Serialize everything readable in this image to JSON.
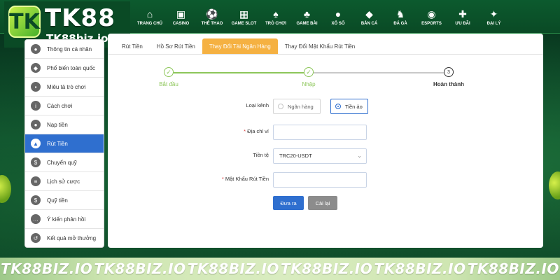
{
  "brand": {
    "logo_letter": "TK",
    "name": "TK88",
    "domain": "TK88biz.io",
    "accent": "#f5b142",
    "primary": "#2f6fcf"
  },
  "nav": [
    {
      "icon": "home-icon",
      "glyph": "⌂",
      "label": "TRANG CHỦ"
    },
    {
      "icon": "casino-icon",
      "glyph": "▣",
      "label": "CASINO"
    },
    {
      "icon": "soccer-icon",
      "glyph": "⚽",
      "label": "THỂ THAO"
    },
    {
      "icon": "slot-icon",
      "glyph": "▦",
      "label": "GAME SLOT"
    },
    {
      "icon": "card-icon",
      "glyph": "♠",
      "label": "TRÒ CHƠI"
    },
    {
      "icon": "card-game-icon",
      "glyph": "♣",
      "label": "GAME BÀI"
    },
    {
      "icon": "lottery-icon",
      "glyph": "●",
      "label": "XỔ SỐ"
    },
    {
      "icon": "fish-icon",
      "glyph": "◆",
      "label": "BẮN CÁ"
    },
    {
      "icon": "rooster-icon",
      "glyph": "♞",
      "label": "ĐÁ GÀ"
    },
    {
      "icon": "gamepad-icon",
      "glyph": "◉",
      "label": "ESPORTS"
    },
    {
      "icon": "gift-icon",
      "glyph": "✚",
      "label": "ƯU ĐÃI"
    },
    {
      "icon": "agent-icon",
      "glyph": "✦",
      "label": "ĐẠI LÝ"
    }
  ],
  "sidebar": {
    "items": [
      {
        "label": "Thông tin cá nhân",
        "icon": "user-icon",
        "glyph": "●",
        "active": false
      },
      {
        "label": "Phổ biến toàn quốc",
        "icon": "diamond-icon",
        "glyph": "◆",
        "active": false
      },
      {
        "label": "Miêu tả trò chơi",
        "icon": "gamepad-icon",
        "glyph": "▪",
        "active": false
      },
      {
        "label": "Cách chơi",
        "icon": "info-icon",
        "glyph": "i",
        "active": false
      },
      {
        "label": "Nạp tiền",
        "icon": "piggy-bank-icon",
        "glyph": "●",
        "active": false
      },
      {
        "label": "Rút Tiền",
        "icon": "withdraw-icon",
        "glyph": "▲",
        "active": true
      },
      {
        "label": "Chuyển quỹ",
        "icon": "dollar-icon",
        "glyph": "$",
        "active": false
      },
      {
        "label": "Lịch sử cược",
        "icon": "history-list-icon",
        "glyph": "≡",
        "active": false
      },
      {
        "label": "Quỹ tiền",
        "icon": "coins-icon",
        "glyph": "$",
        "active": false
      },
      {
        "label": "Ý kiến phản hồi",
        "icon": "feedback-icon",
        "glyph": "…",
        "active": false
      },
      {
        "label": "Kết quả mở thưởng",
        "icon": "clock-history-icon",
        "glyph": "↺",
        "active": false
      }
    ]
  },
  "tabs": [
    {
      "label": "Rút Tiền",
      "active": false
    },
    {
      "label": "Hồ Sơ Rút Tiền",
      "active": false
    },
    {
      "label": "Thay Đổi Tài Ngân Hàng",
      "active": true
    },
    {
      "label": "Thay Đổi Mật Khẩu Rút Tiền",
      "active": false
    }
  ],
  "steps": [
    {
      "label": "Bắt đầu",
      "mark": "✓",
      "done": true
    },
    {
      "label": "Nhập",
      "mark": "✓",
      "done": true
    },
    {
      "label": "Hoàn thành",
      "mark": "3",
      "done": false
    }
  ],
  "form": {
    "account_type_label": "Loại kênh",
    "options": [
      {
        "label": "Ngân hàng",
        "selected": false
      },
      {
        "label": "Tiền ảo",
        "selected": true
      }
    ],
    "wallet_label": "Địa chỉ ví",
    "wallet_value": "",
    "currency_label": "Tiền tệ",
    "currency_value": "TRC20-USDT",
    "password_label": "Mật Khẩu Rút Tiền",
    "password_value": "",
    "required_mark": "*",
    "submit_label": "Đưa ra",
    "reset_label": "Cài lại"
  },
  "watermarks": [
    "TK88BIZ.IO",
    "TK88BIZ.IO",
    "TK88BIZ.IO",
    "TK88BIZ.IO",
    "TK88BIZ.IO",
    "TK88BIZ.IO"
  ]
}
